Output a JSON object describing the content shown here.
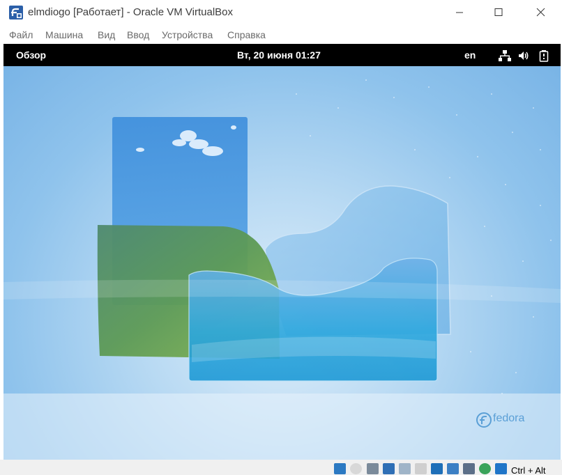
{
  "window": {
    "title": "elmdiogo [Работает] - Oracle VM VirtualBox",
    "app_icon": "virtualbox-fedora-icon"
  },
  "menu": {
    "items": [
      "Файл",
      "Машина",
      "Вид",
      "Ввод",
      "Устройства",
      "Справка"
    ]
  },
  "vm": {
    "topbar": {
      "overview": "Обзор",
      "clock": "Вт, 20 июня  01:27",
      "language": "en",
      "tray_icons": [
        "network-icon",
        "volume-icon",
        "battery-icon"
      ]
    },
    "desktop": {
      "logo_text": "fedora"
    }
  },
  "statusbar": {
    "icons": [
      "disk-icon",
      "optical-drive-icon",
      "audio-icon",
      "network-adapter-icon",
      "usb-icon",
      "shared-folder-icon",
      "display-icon",
      "recording-icon",
      "cpu-virt-icon",
      "mouse-integration-icon",
      "host-key-arrow-icon"
    ],
    "host_key": "Ctrl + Alt"
  },
  "colors": {
    "topbar": "#000000",
    "desktop_sky": "#8fc3ec",
    "accent_blue": "#2b79c2"
  }
}
